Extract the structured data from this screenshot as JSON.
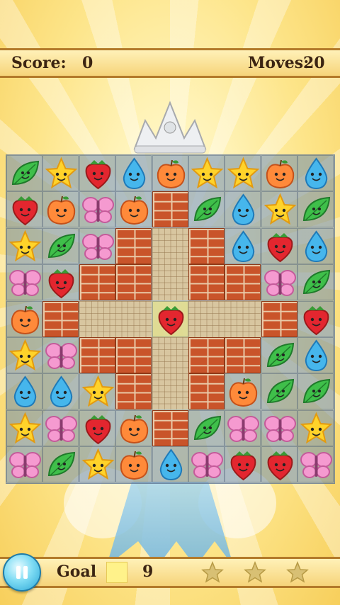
{
  "hud": {
    "score_label": "Score:",
    "score_value": "0",
    "moves_label": "Moves:",
    "moves_value": "20"
  },
  "footer": {
    "goal_label": "Goal",
    "goal_value": "9",
    "stars_earned": 0,
    "stars_total": 3
  },
  "colors": {
    "bar_border": "#b37a2a",
    "text": "#3b2412",
    "goal_swatch": "#fff28a"
  },
  "board": {
    "cols": 9,
    "rows": 9,
    "legend": {
      "L": "leaf",
      "S": "star",
      "R": "strawberry",
      "D": "water-drop",
      "A": "apple",
      "B": "butterfly",
      "#": "brick",
      "=": "stone",
      "*": "strawberry-on-tile"
    },
    "grid": [
      [
        "L",
        "S",
        "R",
        "D",
        "A",
        "S",
        "S",
        "A",
        "D"
      ],
      [
        "R",
        "A",
        "B",
        "A",
        "#",
        "L",
        "D",
        "S",
        "L"
      ],
      [
        "S",
        "L",
        "B",
        "#",
        "=",
        "#",
        "D",
        "R",
        "D"
      ],
      [
        "B",
        "R",
        "#",
        "#",
        "=",
        "#",
        "#",
        "B",
        "L"
      ],
      [
        "A",
        "#",
        "=",
        "=",
        "*",
        "=",
        "=",
        "#",
        "R"
      ],
      [
        "S",
        "B",
        "#",
        "#",
        "=",
        "#",
        "#",
        "L",
        "D"
      ],
      [
        "D",
        "D",
        "S",
        "#",
        "=",
        "#",
        "A",
        "L",
        "L"
      ],
      [
        "S",
        "B",
        "R",
        "A",
        "#",
        "L",
        "B",
        "B",
        "S"
      ],
      [
        "B",
        "L",
        "S",
        "A",
        "D",
        "B",
        "R",
        "R",
        "B"
      ]
    ]
  }
}
